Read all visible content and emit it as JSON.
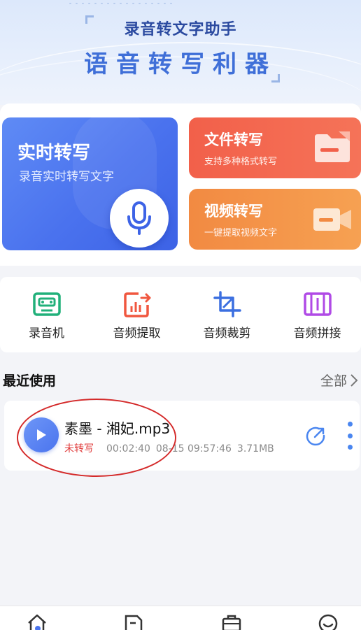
{
  "banner": {
    "subtitle": "录音转文字助手",
    "headline": "语音转写利器"
  },
  "features": {
    "realtime": {
      "title": "实时转写",
      "desc": "录音实时转写文字",
      "icon": "microphone-icon"
    },
    "file": {
      "title": "文件转写",
      "desc": "支持多种格式转写",
      "icon": "folder-icon"
    },
    "video": {
      "title": "视频转写",
      "desc": "一键提取视频文字",
      "icon": "video-camera-icon"
    }
  },
  "tools": [
    {
      "label": "录音机",
      "icon": "cassette-icon",
      "color": "#21b07a"
    },
    {
      "label": "音频提取",
      "icon": "audio-extract-icon",
      "color": "#f0573f"
    },
    {
      "label": "音频裁剪",
      "icon": "crop-icon",
      "color": "#3b6fe0"
    },
    {
      "label": "音频拼接",
      "icon": "merge-icon",
      "color": "#b04ae6"
    }
  ],
  "recent": {
    "title": "最近使用",
    "all_label": "全部",
    "items": [
      {
        "name": "素墨 - 湘妃.mp3",
        "status": "未转写",
        "duration": "00:02:40",
        "datetime": "08-15 09:57:46",
        "size": "3.71MB"
      }
    ]
  },
  "nav": [
    "home-icon",
    "files-icon",
    "toolbox-icon",
    "profile-icon"
  ],
  "colors": {
    "primary": "#4a72ee",
    "file_card": "#f2604a",
    "video_card": "#f28a42",
    "status_untranscribed": "#e03a3a",
    "highlight": "#d42a2a"
  }
}
